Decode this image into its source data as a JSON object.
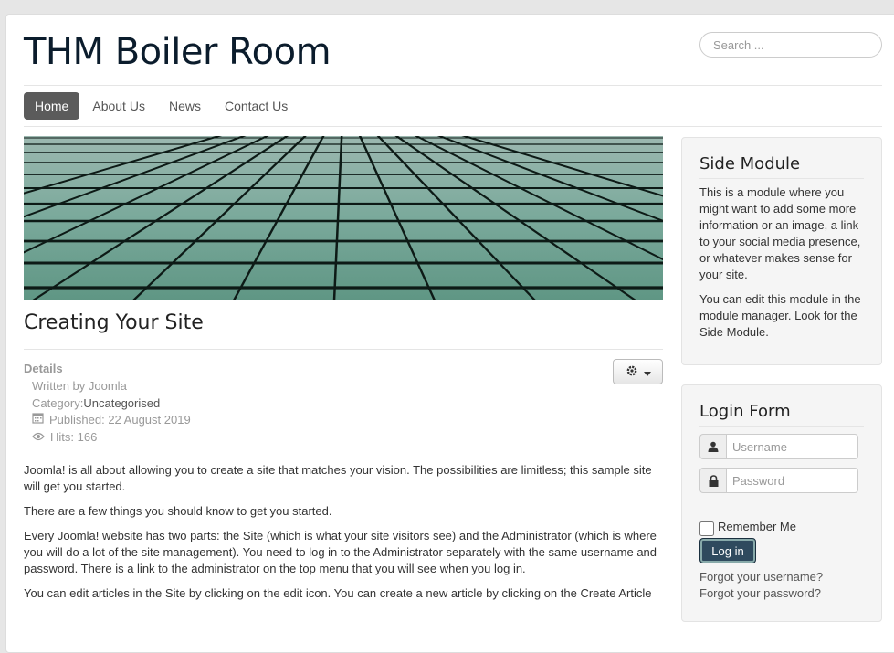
{
  "site": {
    "title": "THM Boiler Room"
  },
  "search": {
    "placeholder": "Search ..."
  },
  "nav": {
    "items": [
      "Home",
      "About Us",
      "News",
      "Contact Us"
    ]
  },
  "article": {
    "title": "Creating Your Site",
    "details_label": "Details",
    "written_by": "Written by Joomla",
    "category_label": "Category: ",
    "category_value": "Uncategorised",
    "published": "Published: 22 August 2019",
    "hits": "Hits: 166",
    "paragraphs": [
      "Joomla! is all about allowing you to create a site that matches your vision. The possibilities are limitless; this sample site will get you started.",
      "There are a few things you should know to get you started.",
      "Every Joomla! website has two parts: the Site (which is what your site visitors see) and the Administrator (which is where you will do a lot of the site management). You need to log in to the Administrator separately with the same username and password. There is a link to the administrator on the top menu that you will see when you log in.",
      "You can edit articles in the Site by clicking on the edit icon. You can create a new article by clicking on the Create Article"
    ]
  },
  "side_module": {
    "title": "Side Module",
    "p1": "This is a module where you might want to add some more information or an image, a link to your social media presence, or whatever makes sense for your site.",
    "p2": "You can edit this module in the module manager. Look for the Side Module."
  },
  "login": {
    "title": "Login Form",
    "username_placeholder": "Username",
    "password_placeholder": "Password",
    "remember_label": "Remember Me",
    "login_button": "Log in",
    "forgot_username": "Forgot your username?",
    "forgot_password": "Forgot your password?"
  },
  "icons": [
    "gear-icon",
    "caret-down-icon",
    "calendar-icon",
    "eye-icon",
    "user-icon",
    "lock-icon"
  ]
}
